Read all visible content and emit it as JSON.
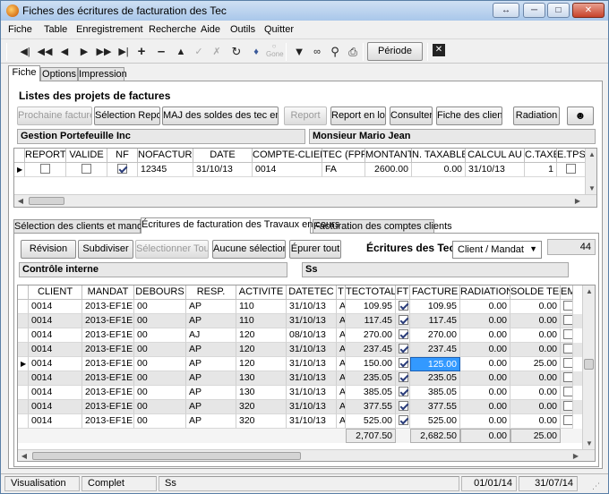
{
  "window": {
    "title": "Fiches des écritures de facturation des Tec"
  },
  "menu": [
    "Fiche",
    "Table",
    "Enregistrement",
    "Recherche",
    "Aide",
    "Outils",
    "Quitter"
  ],
  "toolbar": {
    "periode_label": "Période",
    "gone_label": "Gone"
  },
  "main_tabs": [
    "Fiche",
    "Options",
    "Impression"
  ],
  "projects": {
    "heading": "Listes des projets de factures",
    "buttons": [
      "Prochaine facture",
      "Sélection Report",
      "MAJ des soldes des tec en lot",
      "Report",
      "Report en lot",
      "Consulter",
      "Fiche des clients",
      "Radiation"
    ],
    "company_field": "Gestion Portefeuille Inc",
    "person_field": "Monsieur Mario Jean",
    "columns": [
      "REPORT",
      "VALIDE",
      "NF",
      "NOFACTURE",
      "DATE",
      "COMPTE-CLIENT",
      "TEC (FPR)",
      "MONTANT",
      "N. TAXABLE",
      "CALCUL AU",
      "C.TAXE",
      "E.TPS"
    ],
    "row": {
      "report": false,
      "valide": false,
      "nf": true,
      "nofacture": "12345",
      "date": "31/10/13",
      "compte_client": "0014",
      "tec": "FA",
      "montant": "2600.00",
      "n_taxable": "0.00",
      "calcul_au": "31/10/13",
      "c_taxe": "1",
      "e_tps": false
    }
  },
  "sub_tabs": [
    "Sélection des clients et mandats",
    "Écritures de facturation des Travaux en cours",
    "Facturation des comptes clients"
  ],
  "entries": {
    "buttons": [
      "Révision",
      "Subdiviser",
      "Sélectionner Tout",
      "Aucune sélection",
      "Épurer tout"
    ],
    "heading": "Écritures des Tec",
    "dropdown_value": "Client / Mandat",
    "count": "44",
    "field_left": "Contrôle interne",
    "field_right": "Ss",
    "columns": [
      "CLIENT",
      "MANDAT",
      "DEBOURS",
      "RESP.",
      "ACTIVITE",
      "DATETEC",
      "T",
      "TECTOTAL",
      "FT",
      "FACTURE",
      "RADIATION",
      "SOLDE TEC",
      "EM"
    ],
    "rows": [
      {
        "client": "0014",
        "mandat": "2013-EF1E",
        "debours": "00",
        "resp": "AP",
        "activite": "110",
        "datetec": "31/10/13",
        "t": "A",
        "tectotal": "109.95",
        "ft": true,
        "facture": "109.95",
        "radiation": "0.00",
        "solde": "0.00"
      },
      {
        "client": "0014",
        "mandat": "2013-EF1E",
        "debours": "00",
        "resp": "AP",
        "activite": "110",
        "datetec": "31/10/13",
        "t": "A",
        "tectotal": "117.45",
        "ft": true,
        "facture": "117.45",
        "radiation": "0.00",
        "solde": "0.00"
      },
      {
        "client": "0014",
        "mandat": "2013-EF1E",
        "debours": "00",
        "resp": "AJ",
        "activite": "120",
        "datetec": "08/10/13",
        "t": "A",
        "tectotal": "270.00",
        "ft": true,
        "facture": "270.00",
        "radiation": "0.00",
        "solde": "0.00"
      },
      {
        "client": "0014",
        "mandat": "2013-EF1E",
        "debours": "00",
        "resp": "AP",
        "activite": "120",
        "datetec": "31/10/13",
        "t": "A",
        "tectotal": "237.45",
        "ft": true,
        "facture": "237.45",
        "radiation": "0.00",
        "solde": "0.00"
      },
      {
        "client": "0014",
        "mandat": "2013-EF1E",
        "debours": "00",
        "resp": "AP",
        "activite": "120",
        "datetec": "31/10/13",
        "t": "A",
        "tectotal": "150.00",
        "ft": true,
        "facture": "125.00",
        "radiation": "0.00",
        "solde": "25.00"
      },
      {
        "client": "0014",
        "mandat": "2013-EF1E",
        "debours": "00",
        "resp": "AP",
        "activite": "130",
        "datetec": "31/10/13",
        "t": "A",
        "tectotal": "235.05",
        "ft": true,
        "facture": "235.05",
        "radiation": "0.00",
        "solde": "0.00"
      },
      {
        "client": "0014",
        "mandat": "2013-EF1E",
        "debours": "00",
        "resp": "AP",
        "activite": "130",
        "datetec": "31/10/13",
        "t": "A",
        "tectotal": "385.05",
        "ft": true,
        "facture": "385.05",
        "radiation": "0.00",
        "solde": "0.00"
      },
      {
        "client": "0014",
        "mandat": "2013-EF1E",
        "debours": "00",
        "resp": "AP",
        "activite": "320",
        "datetec": "31/10/13",
        "t": "A",
        "tectotal": "377.55",
        "ft": true,
        "facture": "377.55",
        "radiation": "0.00",
        "solde": "0.00"
      },
      {
        "client": "0014",
        "mandat": "2013-EF1E",
        "debours": "00",
        "resp": "AP",
        "activite": "320",
        "datetec": "31/10/13",
        "t": "A",
        "tectotal": "525.00",
        "ft": true,
        "facture": "525.00",
        "radiation": "0.00",
        "solde": "0.00"
      }
    ],
    "totals": {
      "tectotal": "2,707.50",
      "facture": "2,682.50",
      "radiation": "0.00",
      "solde": "25.00"
    }
  },
  "status": {
    "mode": "Visualisation",
    "state": "Complet",
    "user": "Ss",
    "date_from": "01/01/14",
    "date_to": "31/07/14"
  },
  "colors": {
    "selected_cell": "#3399ff",
    "alt_row": "#e6e6e6"
  }
}
